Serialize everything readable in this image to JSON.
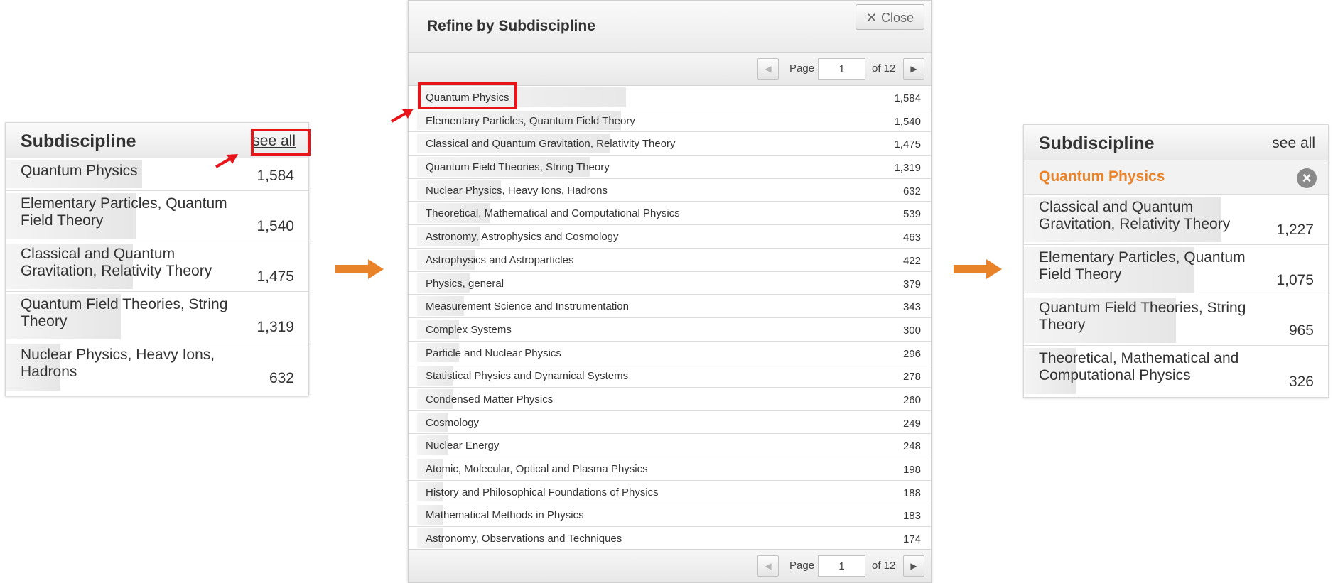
{
  "left_panel": {
    "title": "Subdiscipline",
    "see_all": "see all",
    "items": [
      {
        "label": "Quantum Physics",
        "count": "1,584",
        "fill": 0.45
      },
      {
        "label": "Elementary Particles, Quantum Field Theory",
        "count": "1,540",
        "fill": 0.43
      },
      {
        "label": "Classical and Quantum Gravitation, Relativity Theory",
        "count": "1,475",
        "fill": 0.42
      },
      {
        "label": "Quantum Field Theories, String Theory",
        "count": "1,319",
        "fill": 0.38
      },
      {
        "label": "Nuclear Physics, Heavy Ions, Hadrons",
        "count": "632",
        "fill": 0.18
      }
    ]
  },
  "modal": {
    "title": "Refine by Subdiscipline",
    "close_label": "Close",
    "close_icon": "close-x-icon",
    "pager": {
      "page_label": "Page",
      "page_value": "1",
      "of_label": "of 12"
    },
    "items": [
      {
        "label": "Quantum Physics",
        "count": "1,584",
        "fill": 0.4
      },
      {
        "label": "Elementary Particles, Quantum Field Theory",
        "count": "1,540",
        "fill": 0.39
      },
      {
        "label": "Classical and Quantum Gravitation, Relativity Theory",
        "count": "1,475",
        "fill": 0.37
      },
      {
        "label": "Quantum Field Theories, String Theory",
        "count": "1,319",
        "fill": 0.33
      },
      {
        "label": "Nuclear Physics, Heavy Ions, Hadrons",
        "count": "632",
        "fill": 0.16
      },
      {
        "label": "Theoretical, Mathematical and Computational Physics",
        "count": "539",
        "fill": 0.14
      },
      {
        "label": "Astronomy, Astrophysics and Cosmology",
        "count": "463",
        "fill": 0.12
      },
      {
        "label": "Astrophysics and Astroparticles",
        "count": "422",
        "fill": 0.11
      },
      {
        "label": "Physics, general",
        "count": "379",
        "fill": 0.1
      },
      {
        "label": "Measurement Science and Instrumentation",
        "count": "343",
        "fill": 0.09
      },
      {
        "label": "Complex Systems",
        "count": "300",
        "fill": 0.08
      },
      {
        "label": "Particle and Nuclear Physics",
        "count": "296",
        "fill": 0.08
      },
      {
        "label": "Statistical Physics and Dynamical Systems",
        "count": "278",
        "fill": 0.07
      },
      {
        "label": "Condensed Matter Physics",
        "count": "260",
        "fill": 0.07
      },
      {
        "label": "Cosmology",
        "count": "249",
        "fill": 0.06
      },
      {
        "label": "Nuclear Energy",
        "count": "248",
        "fill": 0.06
      },
      {
        "label": "Atomic, Molecular, Optical and Plasma Physics",
        "count": "198",
        "fill": 0.05
      },
      {
        "label": "History and Philosophical Foundations of Physics",
        "count": "188",
        "fill": 0.05
      },
      {
        "label": "Mathematical Methods in Physics",
        "count": "183",
        "fill": 0.05
      },
      {
        "label": "Astronomy, Observations and Techniques",
        "count": "174",
        "fill": 0.05
      }
    ]
  },
  "right_panel": {
    "title": "Subdiscipline",
    "see_all": "see all",
    "selected": {
      "label": "Quantum Physics",
      "remove_icon": "remove-circle-icon"
    },
    "items": [
      {
        "label": "Classical and Quantum Gravitation, Relativity Theory",
        "count": "1,227",
        "fill": 0.65
      },
      {
        "label": "Elementary Particles, Quantum Field Theory",
        "count": "1,075",
        "fill": 0.56
      },
      {
        "label": "Quantum Field Theories, String Theory",
        "count": "965",
        "fill": 0.5
      },
      {
        "label": "Theoretical, Mathematical and Computational Physics",
        "count": "326",
        "fill": 0.17
      }
    ]
  },
  "colors": {
    "highlight_red": "#e8141a",
    "flow_orange": "#e8832a",
    "selected_orange": "#e8832a"
  },
  "icons": [
    "right-flow-arrow-icon",
    "red-pointer-arrow-icon",
    "pager-prev-icon",
    "pager-next-icon"
  ]
}
